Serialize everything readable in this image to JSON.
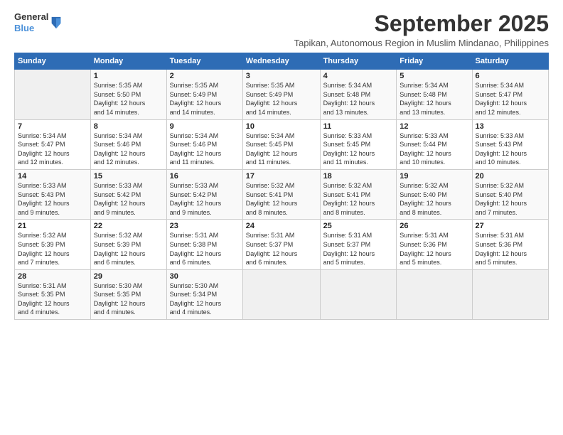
{
  "header": {
    "logo": {
      "line1": "General",
      "line2": "Blue"
    },
    "month": "September 2025",
    "location": "Tapikan, Autonomous Region in Muslim Mindanao, Philippines"
  },
  "days_of_week": [
    "Sunday",
    "Monday",
    "Tuesday",
    "Wednesday",
    "Thursday",
    "Friday",
    "Saturday"
  ],
  "weeks": [
    [
      {
        "day": "",
        "info": ""
      },
      {
        "day": "1",
        "info": "Sunrise: 5:35 AM\nSunset: 5:50 PM\nDaylight: 12 hours\nand 14 minutes."
      },
      {
        "day": "2",
        "info": "Sunrise: 5:35 AM\nSunset: 5:49 PM\nDaylight: 12 hours\nand 14 minutes."
      },
      {
        "day": "3",
        "info": "Sunrise: 5:35 AM\nSunset: 5:49 PM\nDaylight: 12 hours\nand 14 minutes."
      },
      {
        "day": "4",
        "info": "Sunrise: 5:34 AM\nSunset: 5:48 PM\nDaylight: 12 hours\nand 13 minutes."
      },
      {
        "day": "5",
        "info": "Sunrise: 5:34 AM\nSunset: 5:48 PM\nDaylight: 12 hours\nand 13 minutes."
      },
      {
        "day": "6",
        "info": "Sunrise: 5:34 AM\nSunset: 5:47 PM\nDaylight: 12 hours\nand 12 minutes."
      }
    ],
    [
      {
        "day": "7",
        "info": "Sunrise: 5:34 AM\nSunset: 5:47 PM\nDaylight: 12 hours\nand 12 minutes."
      },
      {
        "day": "8",
        "info": "Sunrise: 5:34 AM\nSunset: 5:46 PM\nDaylight: 12 hours\nand 12 minutes."
      },
      {
        "day": "9",
        "info": "Sunrise: 5:34 AM\nSunset: 5:46 PM\nDaylight: 12 hours\nand 11 minutes."
      },
      {
        "day": "10",
        "info": "Sunrise: 5:34 AM\nSunset: 5:45 PM\nDaylight: 12 hours\nand 11 minutes."
      },
      {
        "day": "11",
        "info": "Sunrise: 5:33 AM\nSunset: 5:45 PM\nDaylight: 12 hours\nand 11 minutes."
      },
      {
        "day": "12",
        "info": "Sunrise: 5:33 AM\nSunset: 5:44 PM\nDaylight: 12 hours\nand 10 minutes."
      },
      {
        "day": "13",
        "info": "Sunrise: 5:33 AM\nSunset: 5:43 PM\nDaylight: 12 hours\nand 10 minutes."
      }
    ],
    [
      {
        "day": "14",
        "info": "Sunrise: 5:33 AM\nSunset: 5:43 PM\nDaylight: 12 hours\nand 9 minutes."
      },
      {
        "day": "15",
        "info": "Sunrise: 5:33 AM\nSunset: 5:42 PM\nDaylight: 12 hours\nand 9 minutes."
      },
      {
        "day": "16",
        "info": "Sunrise: 5:33 AM\nSunset: 5:42 PM\nDaylight: 12 hours\nand 9 minutes."
      },
      {
        "day": "17",
        "info": "Sunrise: 5:32 AM\nSunset: 5:41 PM\nDaylight: 12 hours\nand 8 minutes."
      },
      {
        "day": "18",
        "info": "Sunrise: 5:32 AM\nSunset: 5:41 PM\nDaylight: 12 hours\nand 8 minutes."
      },
      {
        "day": "19",
        "info": "Sunrise: 5:32 AM\nSunset: 5:40 PM\nDaylight: 12 hours\nand 8 minutes."
      },
      {
        "day": "20",
        "info": "Sunrise: 5:32 AM\nSunset: 5:40 PM\nDaylight: 12 hours\nand 7 minutes."
      }
    ],
    [
      {
        "day": "21",
        "info": "Sunrise: 5:32 AM\nSunset: 5:39 PM\nDaylight: 12 hours\nand 7 minutes."
      },
      {
        "day": "22",
        "info": "Sunrise: 5:32 AM\nSunset: 5:39 PM\nDaylight: 12 hours\nand 6 minutes."
      },
      {
        "day": "23",
        "info": "Sunrise: 5:31 AM\nSunset: 5:38 PM\nDaylight: 12 hours\nand 6 minutes."
      },
      {
        "day": "24",
        "info": "Sunrise: 5:31 AM\nSunset: 5:37 PM\nDaylight: 12 hours\nand 6 minutes."
      },
      {
        "day": "25",
        "info": "Sunrise: 5:31 AM\nSunset: 5:37 PM\nDaylight: 12 hours\nand 5 minutes."
      },
      {
        "day": "26",
        "info": "Sunrise: 5:31 AM\nSunset: 5:36 PM\nDaylight: 12 hours\nand 5 minutes."
      },
      {
        "day": "27",
        "info": "Sunrise: 5:31 AM\nSunset: 5:36 PM\nDaylight: 12 hours\nand 5 minutes."
      }
    ],
    [
      {
        "day": "28",
        "info": "Sunrise: 5:31 AM\nSunset: 5:35 PM\nDaylight: 12 hours\nand 4 minutes."
      },
      {
        "day": "29",
        "info": "Sunrise: 5:30 AM\nSunset: 5:35 PM\nDaylight: 12 hours\nand 4 minutes."
      },
      {
        "day": "30",
        "info": "Sunrise: 5:30 AM\nSunset: 5:34 PM\nDaylight: 12 hours\nand 4 minutes."
      },
      {
        "day": "",
        "info": ""
      },
      {
        "day": "",
        "info": ""
      },
      {
        "day": "",
        "info": ""
      },
      {
        "day": "",
        "info": ""
      }
    ]
  ]
}
